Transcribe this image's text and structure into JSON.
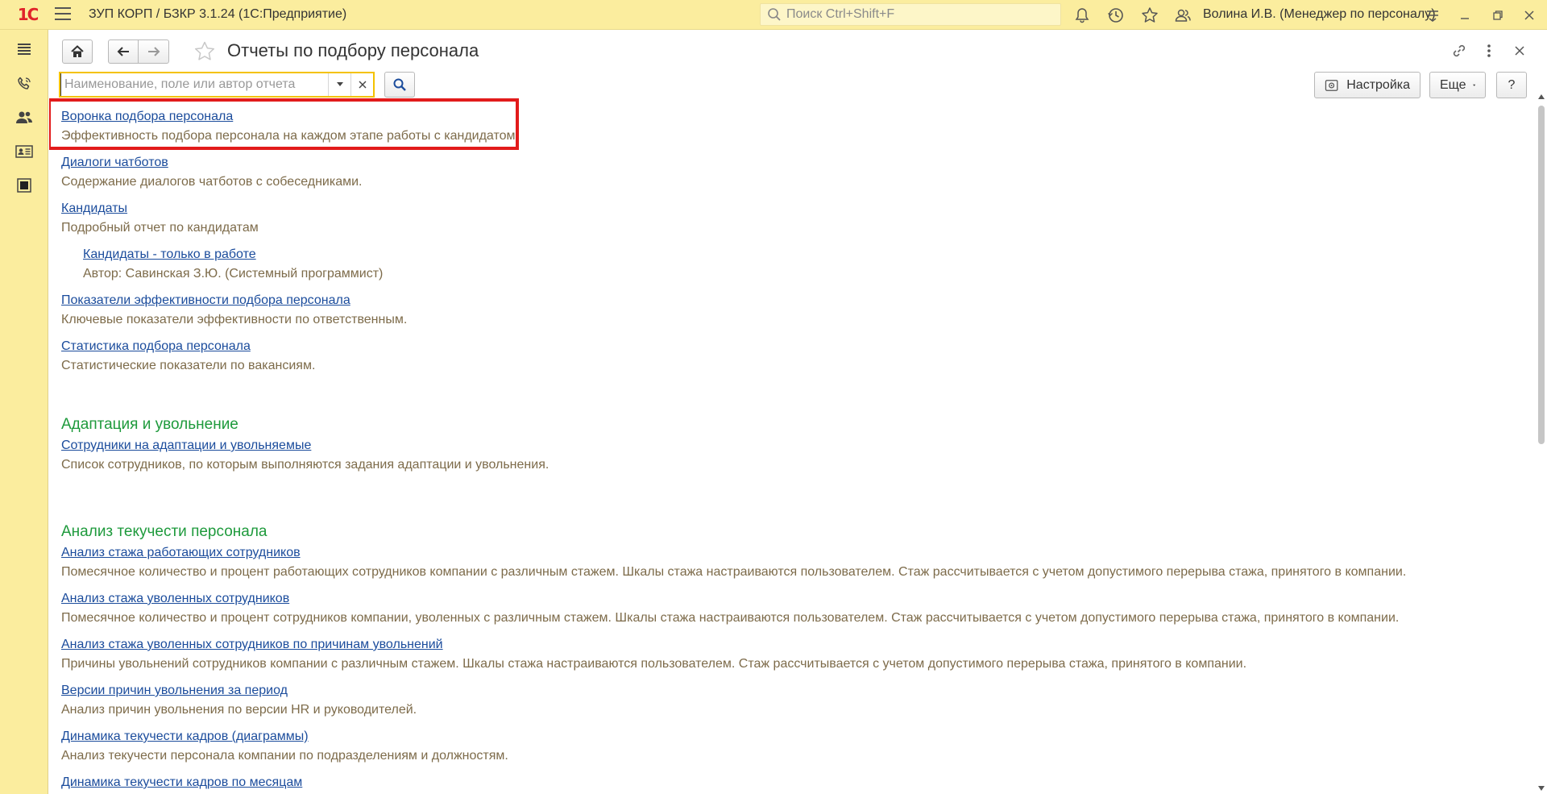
{
  "topbar": {
    "logo": "1С",
    "title": "ЗУП КОРП / БЗКР 3.1.24  (1С:Предприятие)",
    "search_placeholder": "Поиск Ctrl+Shift+F",
    "user": "Волина И.В. (Менеджер по персоналу)"
  },
  "page": {
    "title": "Отчеты по подбору персонала",
    "search_placeholder": "Наименование, поле или автор отчета",
    "settings_label": "Настройка",
    "more_label": "Еще",
    "help_label": "?"
  },
  "reports": {
    "r1": {
      "title": "Воронка подбора персонала",
      "desc": "Эффективность подбора персонала на каждом этапе работы с кандидатом."
    },
    "r2": {
      "title": "Диалоги чатботов",
      "desc": "Содержание диалогов чатботов с собеседниками."
    },
    "r3": {
      "title": "Кандидаты",
      "desc": "Подробный отчет по кандидатам"
    },
    "r3a": {
      "title": "Кандидаты - только в работе",
      "desc": "Автор: Савинская З.Ю. (Системный программист)"
    },
    "r4": {
      "title": "Показатели эффективности подбора персонала",
      "desc": "Ключевые показатели эффективности по ответственным."
    },
    "r5": {
      "title": "Статистика подбора персонала",
      "desc": "Статистические показатели по вакансиям."
    }
  },
  "sections": {
    "s2": {
      "title": "Адаптация и увольнение",
      "r1": {
        "title": "Сотрудники на адаптации и увольняемые",
        "desc": "Список сотрудников, по которым выполняются задания адаптации и увольнения."
      }
    },
    "s3": {
      "title": "Анализ текучести персонала",
      "r1": {
        "title": "Анализ стажа работающих сотрудников",
        "desc": "Помесячное количество и процент работающих сотрудников компании с различным стажем. Шкалы стажа настраиваются пользователем. Стаж рассчитывается с учетом допустимого перерыва стажа, принятого в компании."
      },
      "r2": {
        "title": "Анализ стажа уволенных сотрудников",
        "desc": "Помесячное количество и процент сотрудников компании, уволенных с различным стажем. Шкалы стажа настраиваются пользователем. Стаж рассчитывается с учетом допустимого перерыва стажа, принятого в компании."
      },
      "r3": {
        "title": "Анализ стажа уволенных сотрудников по причинам увольнений",
        "desc": "Причины увольнений сотрудников компании с различным стажем. Шкалы стажа настраиваются пользователем. Стаж рассчитывается с учетом допустимого перерыва стажа, принятого в компании."
      },
      "r4": {
        "title": "Версии причин увольнения за период",
        "desc": "Анализ причин увольнения по версии HR и руководителей."
      },
      "r5": {
        "title": "Динамика текучести кадров (диаграммы)",
        "desc": "Анализ текучести персонала компании по подразделениям и должностям."
      },
      "r6": {
        "title": "Динамика текучести кадров по месяцам"
      }
    }
  },
  "colors": {
    "panel": "#fbed9e",
    "link": "#1b4c9c",
    "description": "#7d6b4a",
    "section": "#1e9a3c",
    "highlight": "#e21b1b",
    "search_focus": "#f4c200"
  }
}
